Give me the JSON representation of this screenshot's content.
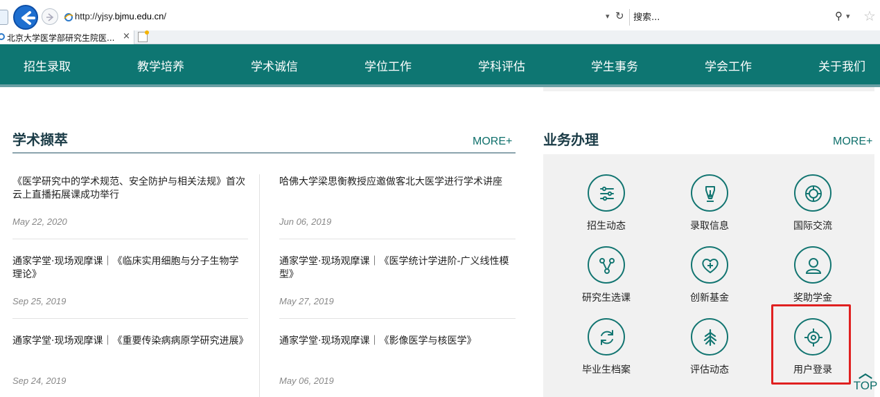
{
  "browser": {
    "url_prefix": "http://yjsy.",
    "url_host": "bjmu.edu.cn",
    "url_suffix": "/",
    "search_placeholder": "搜索...",
    "tab_title": "北京大学医学部研究生院医...",
    "tab_close": "×"
  },
  "nav": {
    "items": [
      "招生录取",
      "教学培养",
      "学术诚信",
      "学位工作",
      "学科评估",
      "学生事务",
      "学会工作",
      "关于我们"
    ]
  },
  "academic": {
    "title": "学术撷萃",
    "more": "MORE+",
    "left": [
      {
        "title": "《医学研究中的学术规范、安全防护与相关法规》首次云上直播拓展课成功举行",
        "date": "May 22, 2020"
      },
      {
        "title": "通家学堂·现场观摩课｜《临床实用细胞与分子生物学理论》",
        "date": "Sep 25, 2019"
      },
      {
        "title": "通家学堂·现场观摩课｜《重要传染病病原学研究进展》",
        "date": "Sep 24, 2019"
      }
    ],
    "right": [
      {
        "title": "哈佛大学梁思衡教授应邀做客北大医学进行学术讲座",
        "date": "Jun 06, 2019"
      },
      {
        "title": "通家学堂·现场观摩课｜《医学统计学进阶-广义线性模型》",
        "date": "May 27, 2019"
      },
      {
        "title": "通家学堂·现场观摩课｜《影像医学与核医学》",
        "date": "May 06, 2019"
      }
    ]
  },
  "business": {
    "title": "业务办理",
    "more": "MORE+",
    "services": [
      {
        "label": "招生动态",
        "icon": "sliders-icon"
      },
      {
        "label": "录取信息",
        "icon": "pen-nib-icon"
      },
      {
        "label": "国际交流",
        "icon": "globe-ring-icon"
      },
      {
        "label": "研究生选课",
        "icon": "branch-icon"
      },
      {
        "label": "创新基金",
        "icon": "heart-plus-icon"
      },
      {
        "label": "奖助学金",
        "icon": "user-icon"
      },
      {
        "label": "毕业生档案",
        "icon": "refresh-icon"
      },
      {
        "label": "评估动态",
        "icon": "leaf-emblem-icon"
      },
      {
        "label": "用户登录",
        "icon": "target-icon"
      }
    ],
    "highlight_color": "#e02020"
  },
  "top_button": {
    "label": "TOP"
  },
  "colors": {
    "brand": "#0e7672",
    "accent": "#0e6f6b"
  }
}
